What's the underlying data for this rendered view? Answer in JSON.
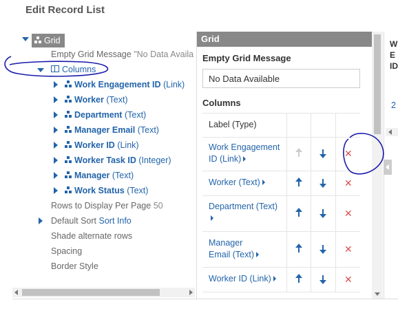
{
  "page": {
    "title": "Edit Record List"
  },
  "tree": {
    "root": "Grid",
    "empty_msg_label": "Empty Grid Message",
    "empty_msg_value": "\"No Data Availa",
    "columns_label": "Columns",
    "columns": [
      {
        "name": "Work Engagement ID",
        "type": "(Link)"
      },
      {
        "name": "Worker",
        "type": "(Text)"
      },
      {
        "name": "Department",
        "type": "(Text)"
      },
      {
        "name": "Manager Email",
        "type": "(Text)"
      },
      {
        "name": "Worker ID",
        "type": "(Link)"
      },
      {
        "name": "Worker Task ID",
        "type": "(Integer)"
      },
      {
        "name": "Manager",
        "type": "(Text)"
      },
      {
        "name": "Work Status",
        "type": "(Text)"
      }
    ],
    "rows_label": "Rows to Display Per Page",
    "rows_value": "50",
    "sort_label": "Default Sort",
    "sort_value": "Sort Info",
    "shade_label": "Shade alternate rows",
    "spacing_label": "Spacing",
    "border_label": "Border Style"
  },
  "panel": {
    "header": "Grid",
    "empty_msg_label": "Empty Grid Message",
    "empty_msg_value": "No Data Available",
    "columns_label": "Columns",
    "table_header": "Label (Type)",
    "rows": [
      {
        "label": "Work Engagement ID (Link)"
      },
      {
        "label": "Worker (Text)"
      },
      {
        "label": "Department (Text)"
      },
      {
        "label": "Manager Email (Text)"
      },
      {
        "label": "Worker ID (Link)"
      }
    ],
    "delete_glyph": "✕"
  },
  "right_panel": {
    "line1": "W",
    "line2": "E",
    "line3": "ID",
    "num": "2"
  },
  "colors": {
    "link": "#2364aa",
    "header_bg": "#888888",
    "delete": "#d9534f",
    "annotation": "#1a1aaa"
  }
}
